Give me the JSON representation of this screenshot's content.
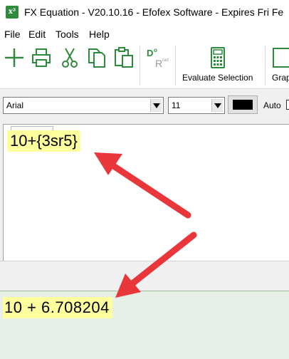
{
  "window": {
    "title": "FX Equation - V20.10.16 - Efofex Software - Expires Fri Fe",
    "app_icon_text": "x²"
  },
  "menu": [
    "File",
    "Edit",
    "Tools",
    "Help"
  ],
  "ribbon": {
    "buttons": [
      "add-icon",
      "print-icon",
      "cut-icon",
      "copy-icon",
      "paste-icon",
      "degrees-radians-icon",
      "calculator-icon",
      "graph-icon"
    ],
    "evaluate_label": "Evaluate Selection",
    "graph_label": "Grap",
    "degrees_text": "D",
    "radians_text": "R",
    "rad_small": "rad",
    "deg_mark": "o"
  },
  "format": {
    "font": "Arial",
    "size": "11",
    "color": "#000000",
    "auto_label": "Auto"
  },
  "editor": {
    "expression": "10+{3sr5}"
  },
  "result": {
    "text": "10 + 6.708204"
  },
  "colors": {
    "highlight": "#ffff9e",
    "result_bg": "#e6f0e6",
    "arrow": "#e8363a",
    "accent_green": "#2e8b3e"
  }
}
